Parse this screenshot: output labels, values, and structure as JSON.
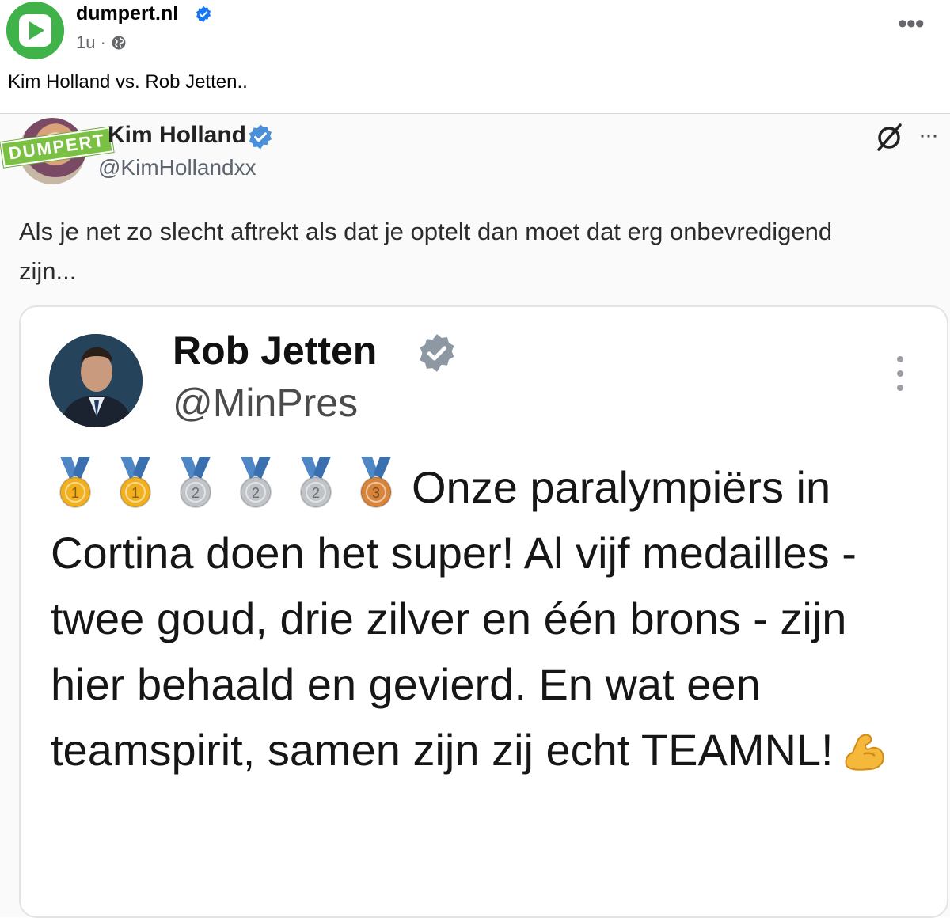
{
  "facebook_post": {
    "page_name": "dumpert.nl",
    "time": "1u",
    "separator": "·",
    "text": "Kim Holland vs. Rob Jetten..",
    "more_label": "•••"
  },
  "kim_tweet": {
    "name": "Kim Holland",
    "handle": "@KimHollandxx",
    "watermark": "DUMPERT",
    "text": "Als je net zo slecht aftrekt als dat je optelt dan moet dat erg onbevredigend zijn...",
    "more_label": "···"
  },
  "rob_tweet": {
    "name": "Rob Jetten",
    "handle": "@MinPres",
    "medals": [
      {
        "type": "gold",
        "number": "1"
      },
      {
        "type": "gold",
        "number": "1"
      },
      {
        "type": "silver",
        "number": "2"
      },
      {
        "type": "silver",
        "number": "2"
      },
      {
        "type": "silver",
        "number": "2"
      },
      {
        "type": "bronze",
        "number": "3"
      }
    ],
    "text": "Onze paralympiërs in Cortina doen het super! Al vijf medailles - twee goud, drie zilver en één brons - zijn hier behaald en gevierd. En wat een teamspirit, samen zijn zij echt TEAMNL!",
    "emoji_end": "flexed-biceps"
  },
  "colors": {
    "dumpert_green": "#3fb34a",
    "fb_verified": "#1877f2",
    "x_verified": "#4a90d9",
    "gold": "#f2b01e",
    "silver": "#c0c4c8",
    "bronze": "#d9843b",
    "ribbon": "#4f86c6"
  }
}
